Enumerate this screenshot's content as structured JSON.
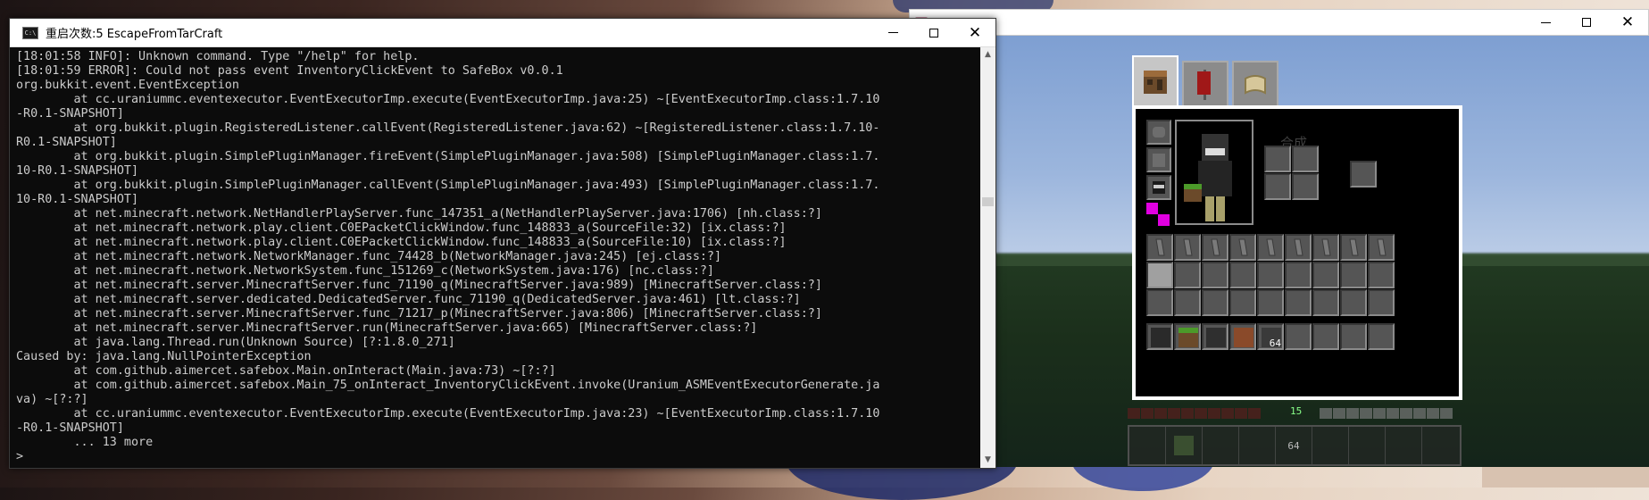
{
  "console": {
    "title": "重启次数:5 EscapeFromTarCraft",
    "lines": [
      "[18:01:58 INFO]: Unknown command. Type \"/help\" for help.",
      "[18:01:59 ERROR]: Could not pass event InventoryClickEvent to SafeBox v0.0.1",
      "org.bukkit.event.EventException",
      "        at cc.uraniummc.eventexecutor.EventExecutorImp.execute(EventExecutorImp.java:25) ~[EventExecutorImp.class:1.7.10",
      "-R0.1-SNAPSHOT]",
      "        at org.bukkit.plugin.RegisteredListener.callEvent(RegisteredListener.java:62) ~[RegisteredListener.class:1.7.10-",
      "R0.1-SNAPSHOT]",
      "        at org.bukkit.plugin.SimplePluginManager.fireEvent(SimplePluginManager.java:508) [SimplePluginManager.class:1.7.",
      "10-R0.1-SNAPSHOT]",
      "        at org.bukkit.plugin.SimplePluginManager.callEvent(SimplePluginManager.java:493) [SimplePluginManager.class:1.7.",
      "10-R0.1-SNAPSHOT]",
      "        at net.minecraft.network.NetHandlerPlayServer.func_147351_a(NetHandlerPlayServer.java:1706) [nh.class:?]",
      "        at net.minecraft.network.play.client.C0EPacketClickWindow.func_148833_a(SourceFile:32) [ix.class:?]",
      "        at net.minecraft.network.play.client.C0EPacketClickWindow.func_148833_a(SourceFile:10) [ix.class:?]",
      "        at net.minecraft.network.NetworkManager.func_74428_b(NetworkManager.java:245) [ej.class:?]",
      "        at net.minecraft.network.NetworkSystem.func_151269_c(NetworkSystem.java:176) [nc.class:?]",
      "        at net.minecraft.server.MinecraftServer.func_71190_q(MinecraftServer.java:989) [MinecraftServer.class:?]",
      "        at net.minecraft.server.dedicated.DedicatedServer.func_71190_q(DedicatedServer.java:461) [lt.class:?]",
      "        at net.minecraft.server.MinecraftServer.func_71217_p(MinecraftServer.java:806) [MinecraftServer.class:?]",
      "        at net.minecraft.server.MinecraftServer.run(MinecraftServer.java:665) [MinecraftServer.class:?]",
      "        at java.lang.Thread.run(Unknown Source) [?:1.8.0_271]",
      "Caused by: java.lang.NullPointerException",
      "        at com.github.aimercet.safebox.Main.onInteract(Main.java:73) ~[?:?]",
      "        at com.github.aimercet.safebox.Main_75_onInteract_InventoryClickEvent.invoke(Uranium_ASMEventExecutorGenerate.ja",
      "va) ~[?:?]",
      "        at cc.uraniummc.eventexecutor.EventExecutorImp.execute(EventExecutorImp.java:23) ~[EventExecutorImp.class:1.7.10",
      "-R0.1-SNAPSHOT]",
      "        ... 13 more",
      ">"
    ]
  },
  "minecraft": {
    "crafting_label": "合成",
    "stack_count": "64",
    "level": "15",
    "colors": {
      "magenta": "#e100e1",
      "slot": "#555555",
      "panel_border": "#ffffff"
    }
  },
  "icons": {
    "console": "console-app-icon",
    "tabs": [
      "crafting-table-icon",
      "red-banner-icon",
      "map-scroll-icon"
    ]
  }
}
